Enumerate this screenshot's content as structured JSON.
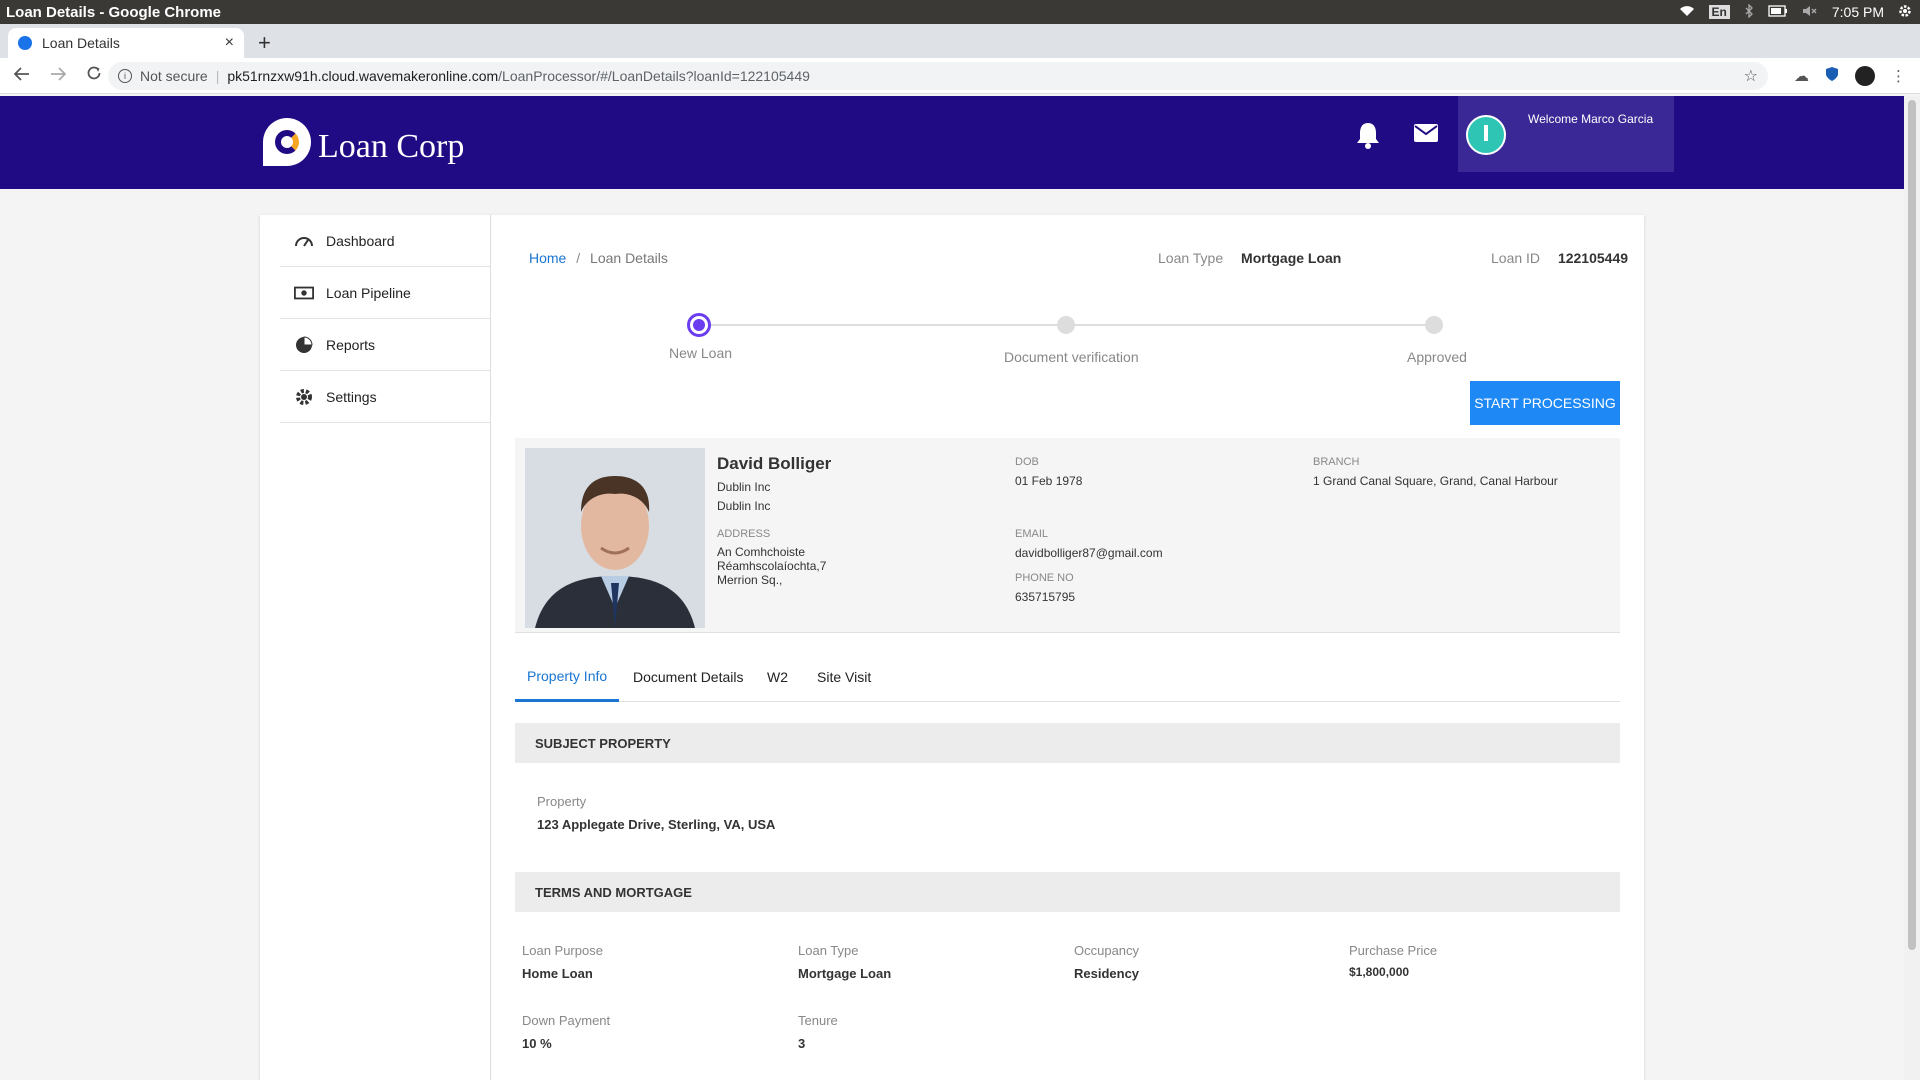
{
  "os": {
    "window_title": "Loan Details - Google Chrome",
    "lang": "En",
    "time": "7:05 PM"
  },
  "browser": {
    "tab_title": "Loan Details",
    "tab_close": "×",
    "new_tab": "+",
    "not_secure": "Not secure",
    "url_host": "pk51rnzxw91h.cloud.wavemakeronline.com",
    "url_path": "/LoanProcessor/#/LoanDetails?loanId=122105449"
  },
  "header": {
    "brand": "Loan Corp",
    "welcome": "Welcome Marco Garcia",
    "bg_color": "#210b84"
  },
  "sidebar": {
    "items": [
      {
        "label": "Dashboard",
        "icon": "dashboard-icon"
      },
      {
        "label": "Loan Pipeline",
        "icon": "money-icon"
      },
      {
        "label": "Reports",
        "icon": "pie-chart-icon"
      },
      {
        "label": "Settings",
        "icon": "gear-icon"
      }
    ]
  },
  "breadcrumb": {
    "home": "Home",
    "sep": "/",
    "current": "Loan Details"
  },
  "loan_meta": {
    "type_label": "Loan Type",
    "type_value": "Mortgage Loan",
    "id_label": "Loan ID",
    "id_value": "122105449"
  },
  "progress": {
    "steps": [
      "New Loan",
      "Document verification",
      "Approved"
    ],
    "active_index": 0
  },
  "start_button": "START PROCESSING",
  "borrower": {
    "name": "David Bolliger",
    "company1": "Dublin Inc",
    "company2": "Dublin Inc",
    "address_label": "ADDRESS",
    "address_line1": "An Comhchoiste",
    "address_line2": "Réamhscolaíochta,7",
    "address_line3": "Merrion Sq.,",
    "dob_label": "DOB",
    "dob": "01 Feb 1978",
    "email_label": "EMAIL",
    "email": "davidbolliger87@gmail.com",
    "phone_label": "PHONE NO",
    "phone": "635715795",
    "branch_label": "BRANCH",
    "branch": "1 Grand Canal Square, Grand, Canal Harbour"
  },
  "tabs": [
    "Property Info",
    "Document Details",
    "W2",
    "Site Visit"
  ],
  "subject_property": {
    "heading": "SUBJECT PROPERTY",
    "property_label": "Property",
    "property_value": "123 Applegate Drive, Sterling, VA, USA"
  },
  "terms": {
    "heading": "TERMS AND MORTGAGE",
    "fields": [
      {
        "label": "Loan Purpose",
        "value": "Home Loan"
      },
      {
        "label": "Loan Type",
        "value": "Mortgage Loan"
      },
      {
        "label": "Occupancy",
        "value": "Residency"
      },
      {
        "label": "Purchase Price",
        "value": "$1,800,000"
      },
      {
        "label": "Down Payment",
        "value": "10 %"
      },
      {
        "label": "Tenure",
        "value": "3"
      }
    ]
  }
}
